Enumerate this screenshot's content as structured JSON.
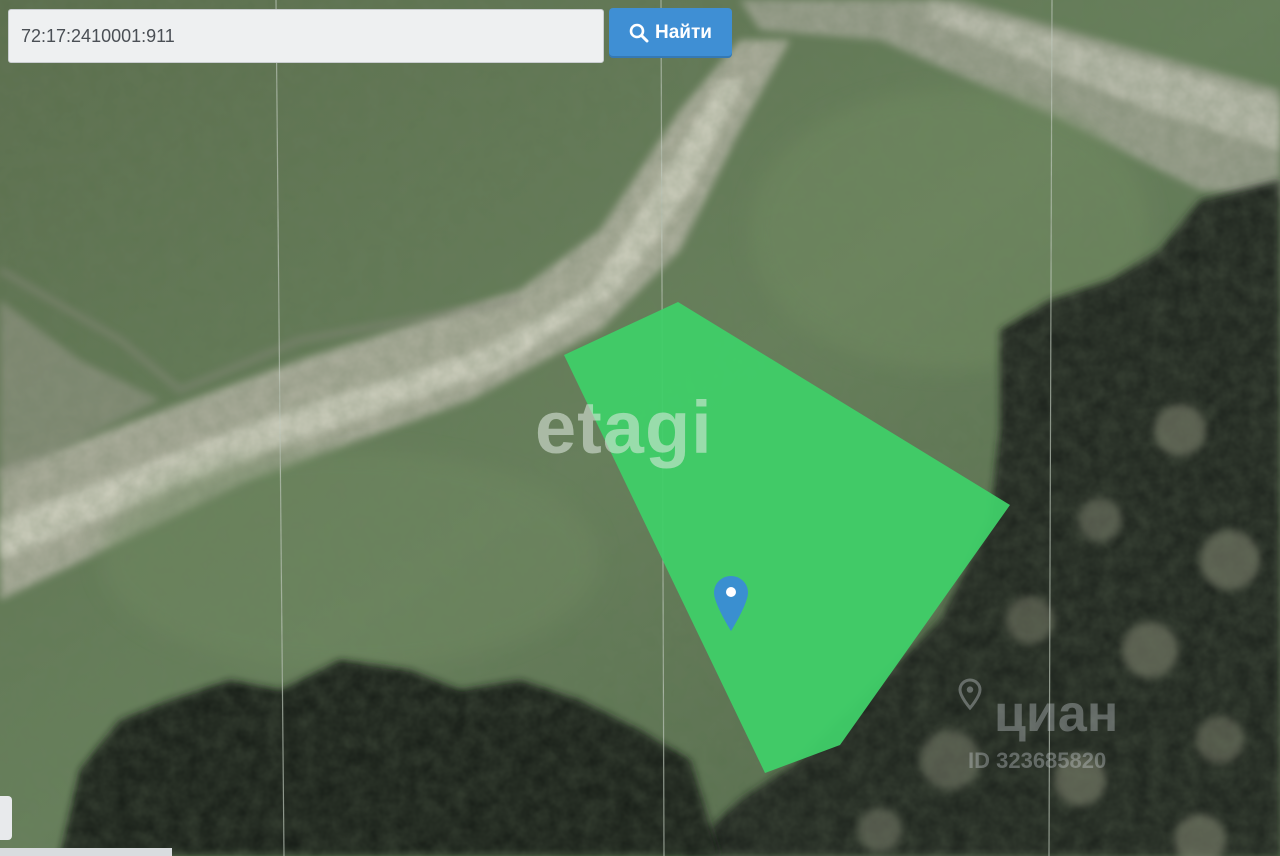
{
  "search": {
    "value": "72:17:2410001:911",
    "button_label": "Найти",
    "button_icon": "search-icon"
  },
  "map": {
    "layer": "satellite",
    "parcel_color": "#3fcf68",
    "marker_color": "#3a8fd0",
    "marker_icon": "map-pin-icon"
  },
  "watermarks": {
    "etagi": "etagi",
    "cian": "циан",
    "cian_id": "ID 323685820"
  },
  "colors": {
    "accent": "#3f8fd4"
  }
}
